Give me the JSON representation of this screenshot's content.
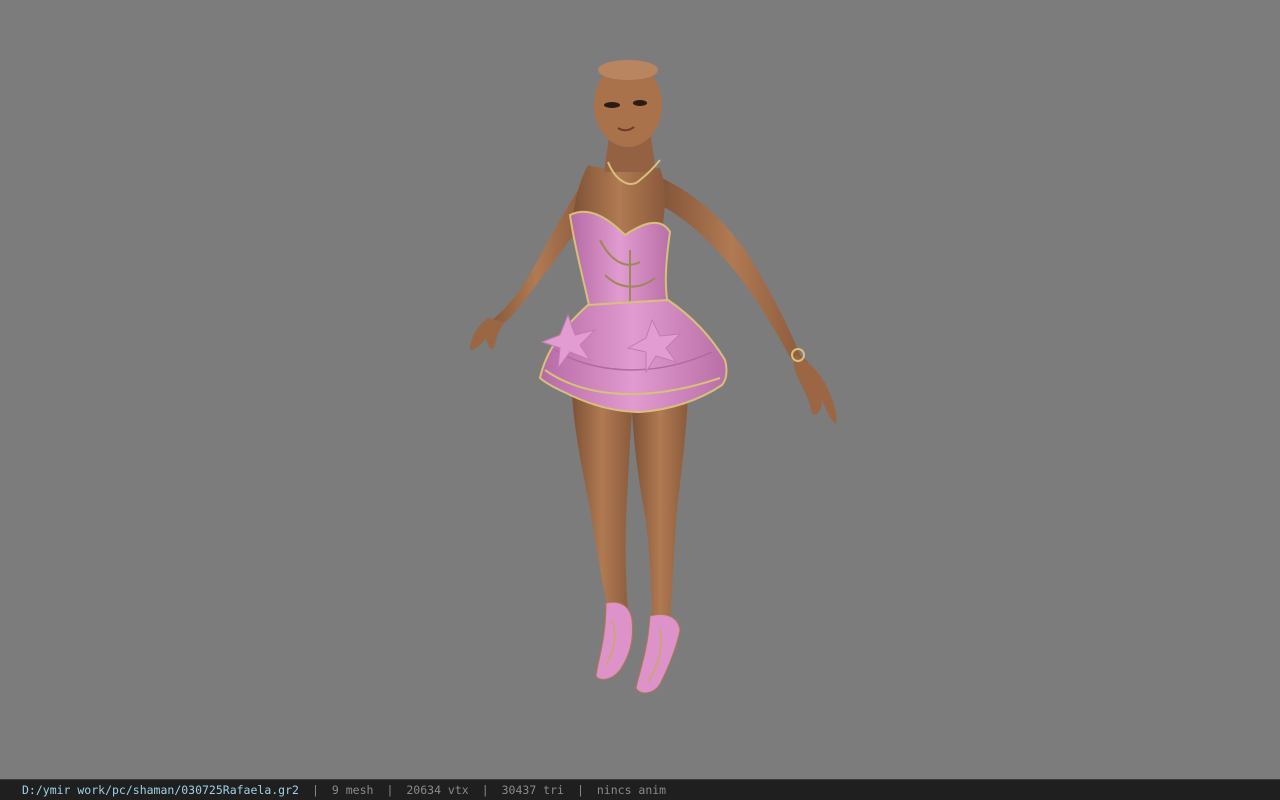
{
  "viewport": {
    "background": "#7c7c7c",
    "model_name": "character-model"
  },
  "statusbar": {
    "file_path": "D:/ymir work/pc/shaman/030725Rafaela.gr2",
    "separator": "|",
    "mesh": "9 mesh",
    "vtx": "20634 vtx",
    "tri": "30437 tri",
    "anim": "nincs anim",
    "path_color": "#9fd0e6",
    "text_color": "#8a8a8a"
  },
  "colors": {
    "skin": "#a9724b",
    "skin_shadow": "#7f5236",
    "dress": "#d88ec4",
    "dress_shadow": "#b06a9f",
    "trim": "#d9c07a"
  }
}
